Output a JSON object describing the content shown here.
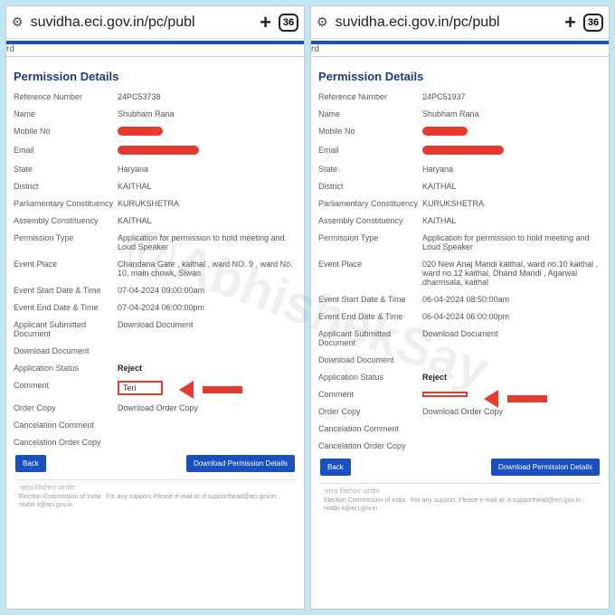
{
  "watermark": "@AbhishekSay",
  "addrbar": {
    "url": "suvidha.eci.gov.in/pc/publ",
    "tabcount": "36"
  },
  "tabband": "rd",
  "section_title": "Permission Details",
  "labels": {
    "ref": "Reference Number",
    "name": "Name",
    "mobile": "Mobile No",
    "email": "Email",
    "state": "State",
    "district": "District",
    "pc": "Parliamentary Constituency",
    "ac": "Assembly Constituency",
    "ptype": "Permission Type",
    "place": "Event Place",
    "start": "Event Start Date & Time",
    "end": "Event End Date & Time",
    "appdoc": "Applicant Submitted Document",
    "dldoc": "Download Document",
    "status": "Application Status",
    "comment": "Comment",
    "order": "Order Copy",
    "cancelc": "Cancelation Comment",
    "cancelo": "Cancelation Order Copy"
  },
  "buttons": {
    "back": "Back",
    "download": "Download Permission Details"
  },
  "footer": {
    "org1": "भारत निर्वाचन आयोग",
    "org2": "Election Commission of India",
    "support": "For any support, Please e-mail at: it-supporthead@eci.gov.in , nodal-it@eci.gov.in"
  },
  "left": {
    "ref": "24PC53738",
    "name": "Shubham Rana",
    "state": "Haryana",
    "district": "KAITHAL",
    "pc": "KURUKSHETRA",
    "ac": "KAITHAL",
    "ptype": "Application for permission to hold meeting and Loud Speaker",
    "place": "Chandana Gate , kaithal , ward NO. 9 , ward No. 10, main chowk, Siwan",
    "start": "07-04-2024 09:00:00am",
    "end": "07-04-2024 06:00:00pm",
    "dldoc": "Download Document",
    "status": "Reject",
    "comment": "Teri",
    "order": "Download Order Copy"
  },
  "right": {
    "ref": "24PC51937",
    "name": "Shubham Rana",
    "state": "Haryana",
    "district": "KAITHAL",
    "pc": "KURUKSHETRA",
    "ac": "KAITHAL",
    "ptype": "Application for permission to hold meeting and Loud Speaker",
    "place": "020 New Anaj Mandi kaithal, ward no.10 kaithal , ward no.12 kaithal, Dhand Mandi , Agarwal dharmsala, kaithal",
    "start": "06-04-2024 08:50:00am",
    "end": "06-04-2024 06:00:00pm",
    "dldoc": "Download Document",
    "status": "Reject",
    "comment": "",
    "order": "Download Order Copy"
  }
}
